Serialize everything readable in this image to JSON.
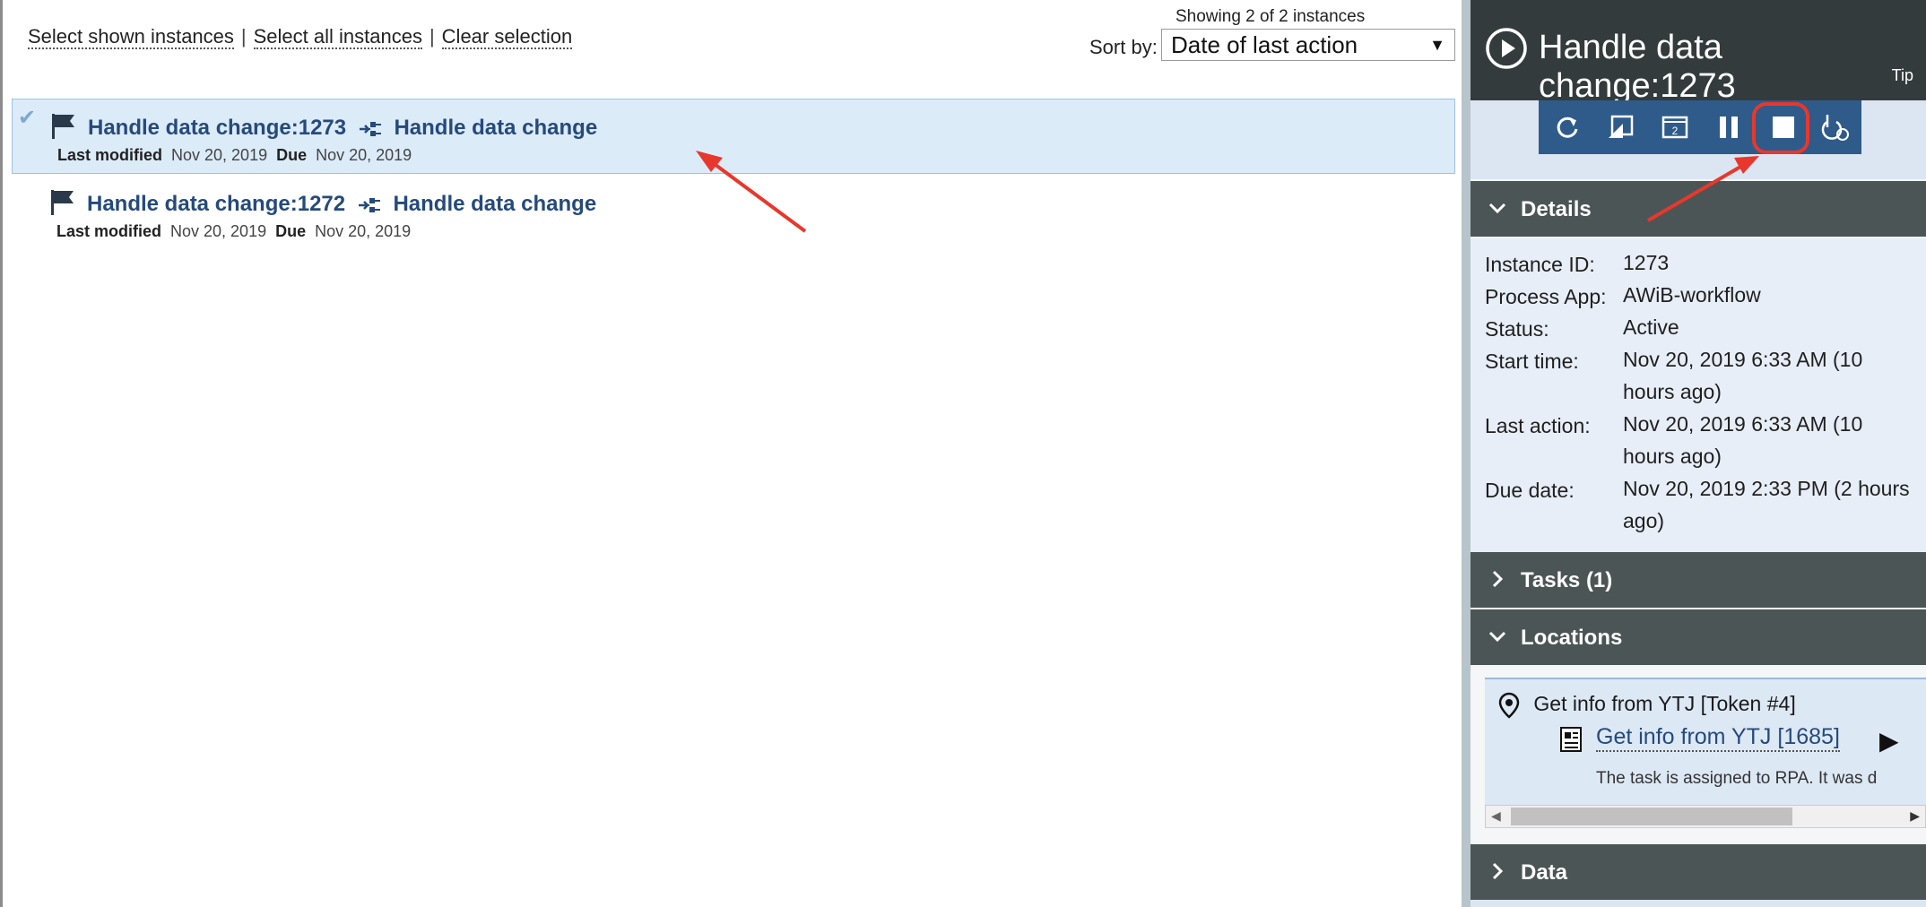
{
  "left": {
    "links": {
      "select_shown": "Select shown instances",
      "select_all": "Select all instances",
      "clear": "Clear selection",
      "separator": "|"
    },
    "showing": "Showing 2 of 2 instances",
    "sort": {
      "label": "Sort by:",
      "value": "Date of last action"
    },
    "instances": [
      {
        "name": "Handle data change:1273",
        "process": "Handle data change",
        "last_modified_label": "Last modified",
        "last_modified": "Nov 20, 2019",
        "due_label": "Due",
        "due": "Nov 20, 2019",
        "selected": true
      },
      {
        "name": "Handle data change:1272",
        "process": "Handle data change",
        "last_modified_label": "Last modified",
        "last_modified": "Nov 20, 2019",
        "due_label": "Due",
        "due": "Nov 20, 2019",
        "selected": false
      }
    ]
  },
  "right": {
    "header": {
      "title": "Handle data change:1273",
      "tip": "Tip"
    },
    "toolbar": [
      "refresh-icon",
      "move-icon",
      "calendar-icon",
      "pause-icon",
      "stop-icon",
      "migrate-icon"
    ],
    "sections": {
      "details": "Details",
      "tasks": "Tasks (1)",
      "locations": "Locations",
      "data": "Data"
    },
    "details": {
      "instance_id": {
        "label": "Instance ID:",
        "value": "1273"
      },
      "process_app": {
        "label": "Process App:",
        "value": "AWiB-workflow"
      },
      "status": {
        "label": "Status:",
        "value": "Active"
      },
      "start_time": {
        "label": "Start time:",
        "value": "Nov 20, 2019 6:33 AM (10 hours ago)"
      },
      "last_action": {
        "label": "Last action:",
        "value": "Nov 20, 2019 6:33 AM (10 hours ago)"
      },
      "due_date": {
        "label": "Due date:",
        "value": "Nov 20, 2019 2:33 PM (2 hours ago)"
      }
    },
    "locations": {
      "token": "Get info from YTJ [Token #4]",
      "task": "Get info from YTJ [1685]",
      "description": "The task is assigned to RPA. It was d"
    }
  },
  "colors": {
    "header_bg": "#333b3c",
    "toolbar_bg": "#2e5b8a",
    "section_bg": "#4c5556",
    "link_blue": "#254a7c",
    "selected_row": "#dcebf8",
    "annotation_red": "#e8372c"
  }
}
